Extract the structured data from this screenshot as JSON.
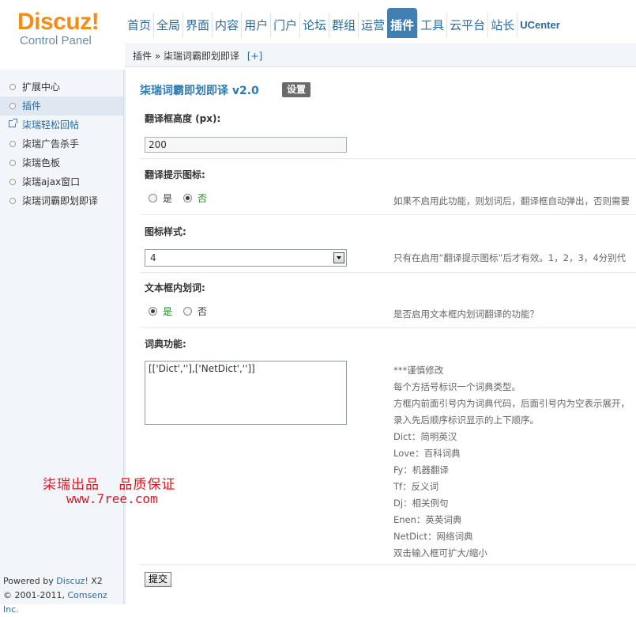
{
  "logo": {
    "main": "Discuz",
    "excl": "!",
    "sub": "Control Panel"
  },
  "nav": {
    "items": [
      {
        "label": "首页"
      },
      {
        "label": "全局"
      },
      {
        "label": "界面"
      },
      {
        "label": "内容"
      },
      {
        "label": "用户"
      },
      {
        "label": "门户"
      },
      {
        "label": "论坛"
      },
      {
        "label": "群组"
      },
      {
        "label": "运营"
      },
      {
        "label": "插件",
        "active": true
      },
      {
        "label": "工具"
      },
      {
        "label": "云平台"
      },
      {
        "label": "站长"
      },
      {
        "label": "UCenter"
      }
    ]
  },
  "breadcrumb": {
    "text": "插件 » 柒瑞词霸即划即译",
    "add": "[+]"
  },
  "sidebar": {
    "items": [
      {
        "label": "扩展中心"
      },
      {
        "label": "插件"
      },
      {
        "label": "柒瑞轻松回帖"
      },
      {
        "label": "柒瑞广告杀手"
      },
      {
        "label": "柒瑞色板"
      },
      {
        "label": "柒瑞ajax窗口"
      },
      {
        "label": "柒瑞词霸即划即译"
      }
    ],
    "powered": {
      "prefix": "Powered by ",
      "brand": "Discuz!",
      "version": " X2",
      "copy": "© 2001-2011, ",
      "company": "Comsenz Inc."
    }
  },
  "main": {
    "title": "柒瑞词霸即划即译 v2.0",
    "settings_label": "设置",
    "height": {
      "label": "翻译框高度 (px):",
      "value": "200"
    },
    "icon_toggle": {
      "label": "翻译提示图标:",
      "yes": "是",
      "no": "否",
      "hint": "如果不启用此功能，则划词后，翻译框自动弹出，否则需要"
    },
    "icon_style": {
      "label": "图标样式:",
      "value": "4",
      "hint": "只有在启用“翻译提示图标”后才有效。1，2，3，4分别代"
    },
    "inline": {
      "label": "文本框内划词:",
      "yes": "是",
      "no": "否",
      "hint": "是否启用文本框内划词翻译的功能？"
    },
    "dict": {
      "label": "词典功能:",
      "value": "[['Dict',''],['NetDict','']]",
      "hints": [
        "***谨慎修改",
        "每个方括号标识一个词典类型。",
        "方框内前面引号内为词典代码，后面引号内为空表示展开，",
        "录入先后顺序标识显示的上下顺序。",
        "Dict：简明英汉",
        "Love：百科词典",
        "Fy：机器翻译",
        "Tf：反义词",
        "Dj：相关例句",
        "Enen：英英词典",
        "NetDict：网络词典",
        "双击输入框可扩大/缩小"
      ]
    },
    "submit_label": "提交"
  },
  "watermark": {
    "line1": "柒瑞出品　 品质保证",
    "line2": "www.7ree.com"
  }
}
